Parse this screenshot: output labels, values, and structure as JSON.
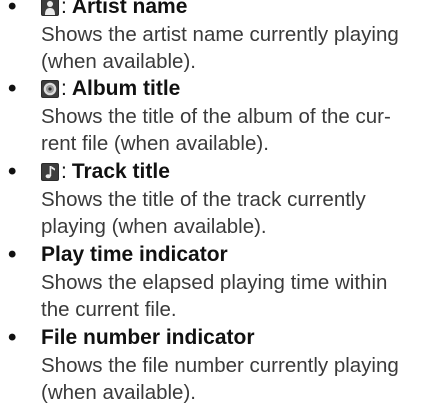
{
  "items": [
    {
      "icon": "artist-icon",
      "title": "Artist name",
      "desc_lines": [
        "Shows the artist name currently playing",
        "(when available)."
      ]
    },
    {
      "icon": "album-disc-icon",
      "title": "Album title",
      "desc_lines": [
        "Shows the title of the album of the cur-",
        "rent file (when available)."
      ]
    },
    {
      "icon": "music-note-icon",
      "title": "Track title",
      "desc_lines": [
        "Shows the title of the track currently",
        "playing (when available)."
      ]
    },
    {
      "icon": null,
      "title": "Play time indicator",
      "desc_lines": [
        "Shows the elapsed playing time within",
        "the current file."
      ]
    },
    {
      "icon": null,
      "title": "File number indicator",
      "desc_lines": [
        "Shows the file number currently playing",
        "(when available)."
      ]
    }
  ],
  "bullet": "•",
  "colon": ":"
}
